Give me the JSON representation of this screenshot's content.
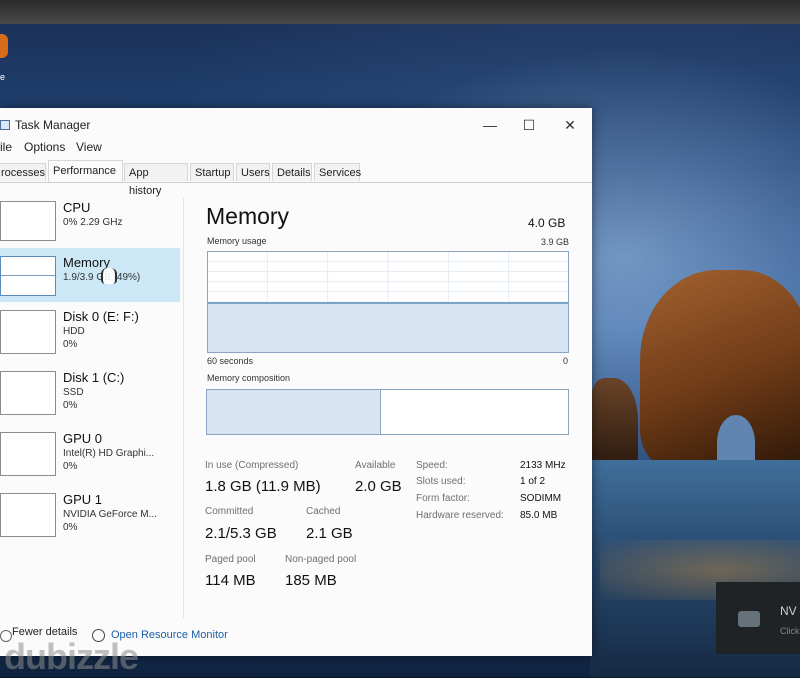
{
  "desktop": {
    "icon_text": "e",
    "notification": {
      "title": "NV",
      "subtitle": "Click"
    },
    "watermark": "dubizzle"
  },
  "window": {
    "title": "Task Manager",
    "controls": {
      "minimize": "—",
      "maximize": "☐",
      "close": "✕"
    }
  },
  "menus": [
    "ile",
    "Options",
    "View"
  ],
  "tabs": [
    "rocesses",
    "Performance",
    "App history",
    "Startup",
    "Users",
    "Details",
    "Services"
  ],
  "active_tab": "Performance",
  "sidebar": {
    "items": [
      {
        "title": "CPU",
        "lines": [
          "0% 2.29 GHz"
        ]
      },
      {
        "title": "Memory",
        "lines": [
          "1.9/3.9 GB (49%)"
        ]
      },
      {
        "title": "Disk 0 (E: F:)",
        "lines": [
          "HDD",
          "0%"
        ]
      },
      {
        "title": "Disk 1 (C:)",
        "lines": [
          "SSD",
          "0%"
        ]
      },
      {
        "title": "GPU 0",
        "lines": [
          "Intel(R) HD Graphi...",
          "0%"
        ]
      },
      {
        "title": "GPU 1",
        "lines": [
          "NVIDIA GeForce M...",
          "0%"
        ]
      }
    ],
    "selected": "Memory"
  },
  "memory": {
    "title": "Memory",
    "total": "4.0 GB",
    "usage_label": "Memory usage",
    "usage_max": "3.9 GB",
    "axis_left": "60 seconds",
    "axis_right": "0",
    "composition_label": "Memory composition",
    "usage_fraction": 0.49,
    "composition": {
      "in_use": 0.48,
      "cached": 0.0
    },
    "stats": {
      "in_use_label": "In use (Compressed)",
      "in_use_value": "1.8 GB (11.9 MB)",
      "available_label": "Available",
      "available_value": "2.0 GB",
      "committed_label": "Committed",
      "committed_value": "2.1/5.3 GB",
      "cached_label": "Cached",
      "cached_value": "2.1 GB",
      "paged_label": "Paged pool",
      "paged_value": "114 MB",
      "nonpaged_label": "Non-paged pool",
      "nonpaged_value": "185 MB"
    },
    "specs": [
      {
        "label": "Speed:",
        "value": "2133 MHz"
      },
      {
        "label": "Slots used:",
        "value": "1 of 2"
      },
      {
        "label": "Form factor:",
        "value": "SODIMM"
      },
      {
        "label": "Hardware reserved:",
        "value": "85.0 MB"
      }
    ]
  },
  "footer": {
    "fewer_details": "Fewer details",
    "resource_monitor": "Open Resource Monitor"
  },
  "colors": {
    "accent": "#1c5fa8",
    "selected_bg": "#cce8f6",
    "chart_line": "#7aa1c8"
  }
}
